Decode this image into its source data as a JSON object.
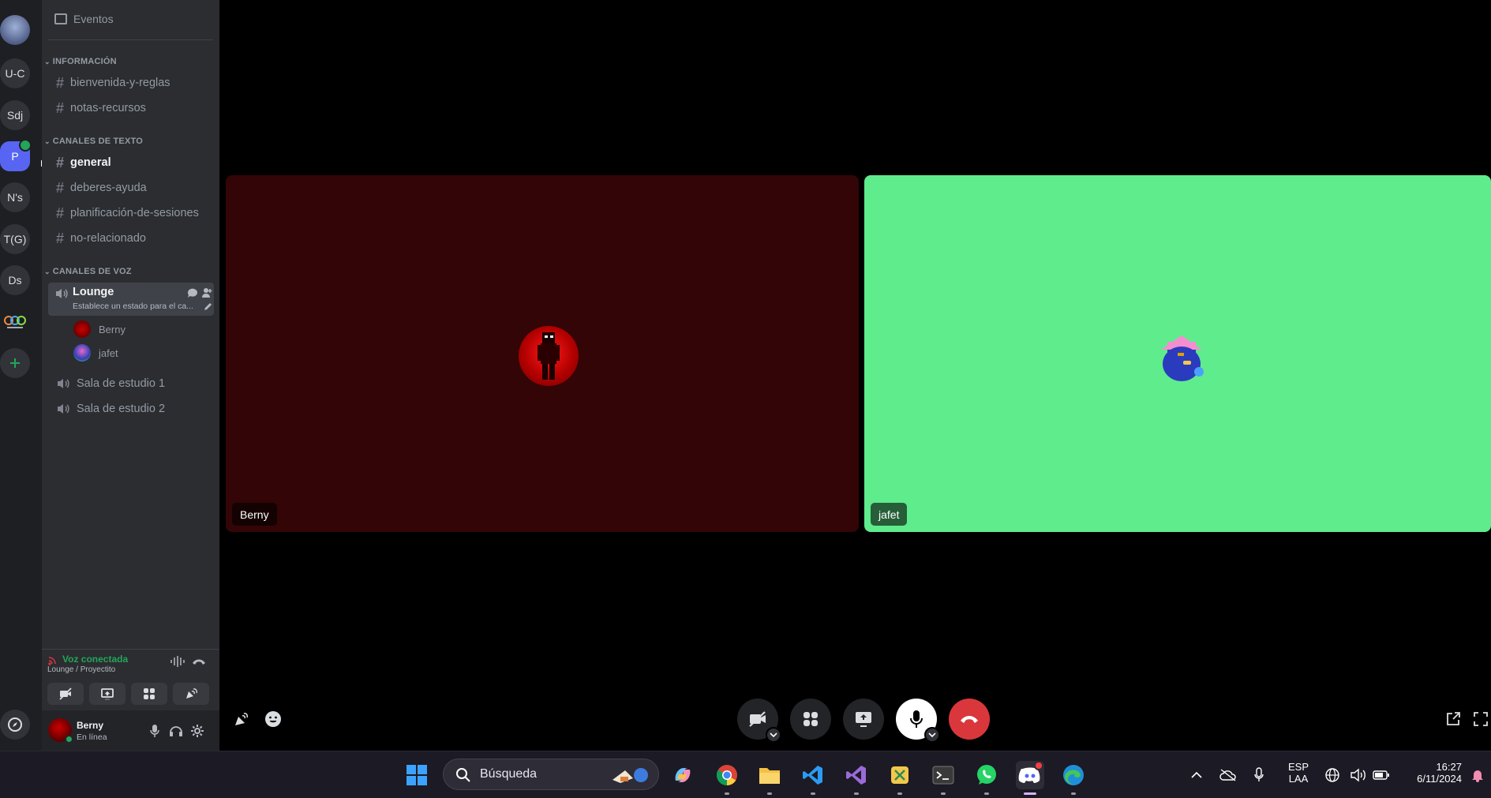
{
  "sidebar": {
    "events_label": "Eventos",
    "categories": {
      "info": "INFORMACIÓN",
      "text": "CANALES DE TEXTO",
      "voice": "CANALES DE VOZ"
    },
    "text_channels_info": [
      "bienvenida-y-reglas",
      "notas-recursos"
    ],
    "text_channels": [
      "general",
      "deberes-ayuda",
      "planificación-de-sesiones",
      "no-relacionado"
    ],
    "selected_channel": "general",
    "voice_channels": {
      "lounge": {
        "name": "Lounge",
        "status": "Establece un estado para el ca...",
        "members": [
          "Berny",
          "jafet"
        ]
      },
      "others": [
        "Sala de estudio 1",
        "Sala de estudio 2"
      ]
    }
  },
  "servers": [
    "U-C",
    "Sdj",
    "P",
    "N's",
    "T(G)",
    "Ds"
  ],
  "voice_panel": {
    "title": "Voz conectada",
    "subtitle": "Lounge / Proyectito"
  },
  "user": {
    "name": "Berny",
    "status": "En línea"
  },
  "stage": {
    "tiles": [
      {
        "name": "Berny",
        "bg": "#330507"
      },
      {
        "name": "jafet",
        "bg": "#5fec8c"
      }
    ]
  },
  "taskbar": {
    "search_label": "Búsqueda",
    "lang_top": "ESP",
    "lang_bottom": "LAA",
    "time": "16:27",
    "date": "6/11/2024"
  },
  "colors": {
    "accent": "#5865f2",
    "online": "#23a55a",
    "hangup": "#da373c"
  }
}
